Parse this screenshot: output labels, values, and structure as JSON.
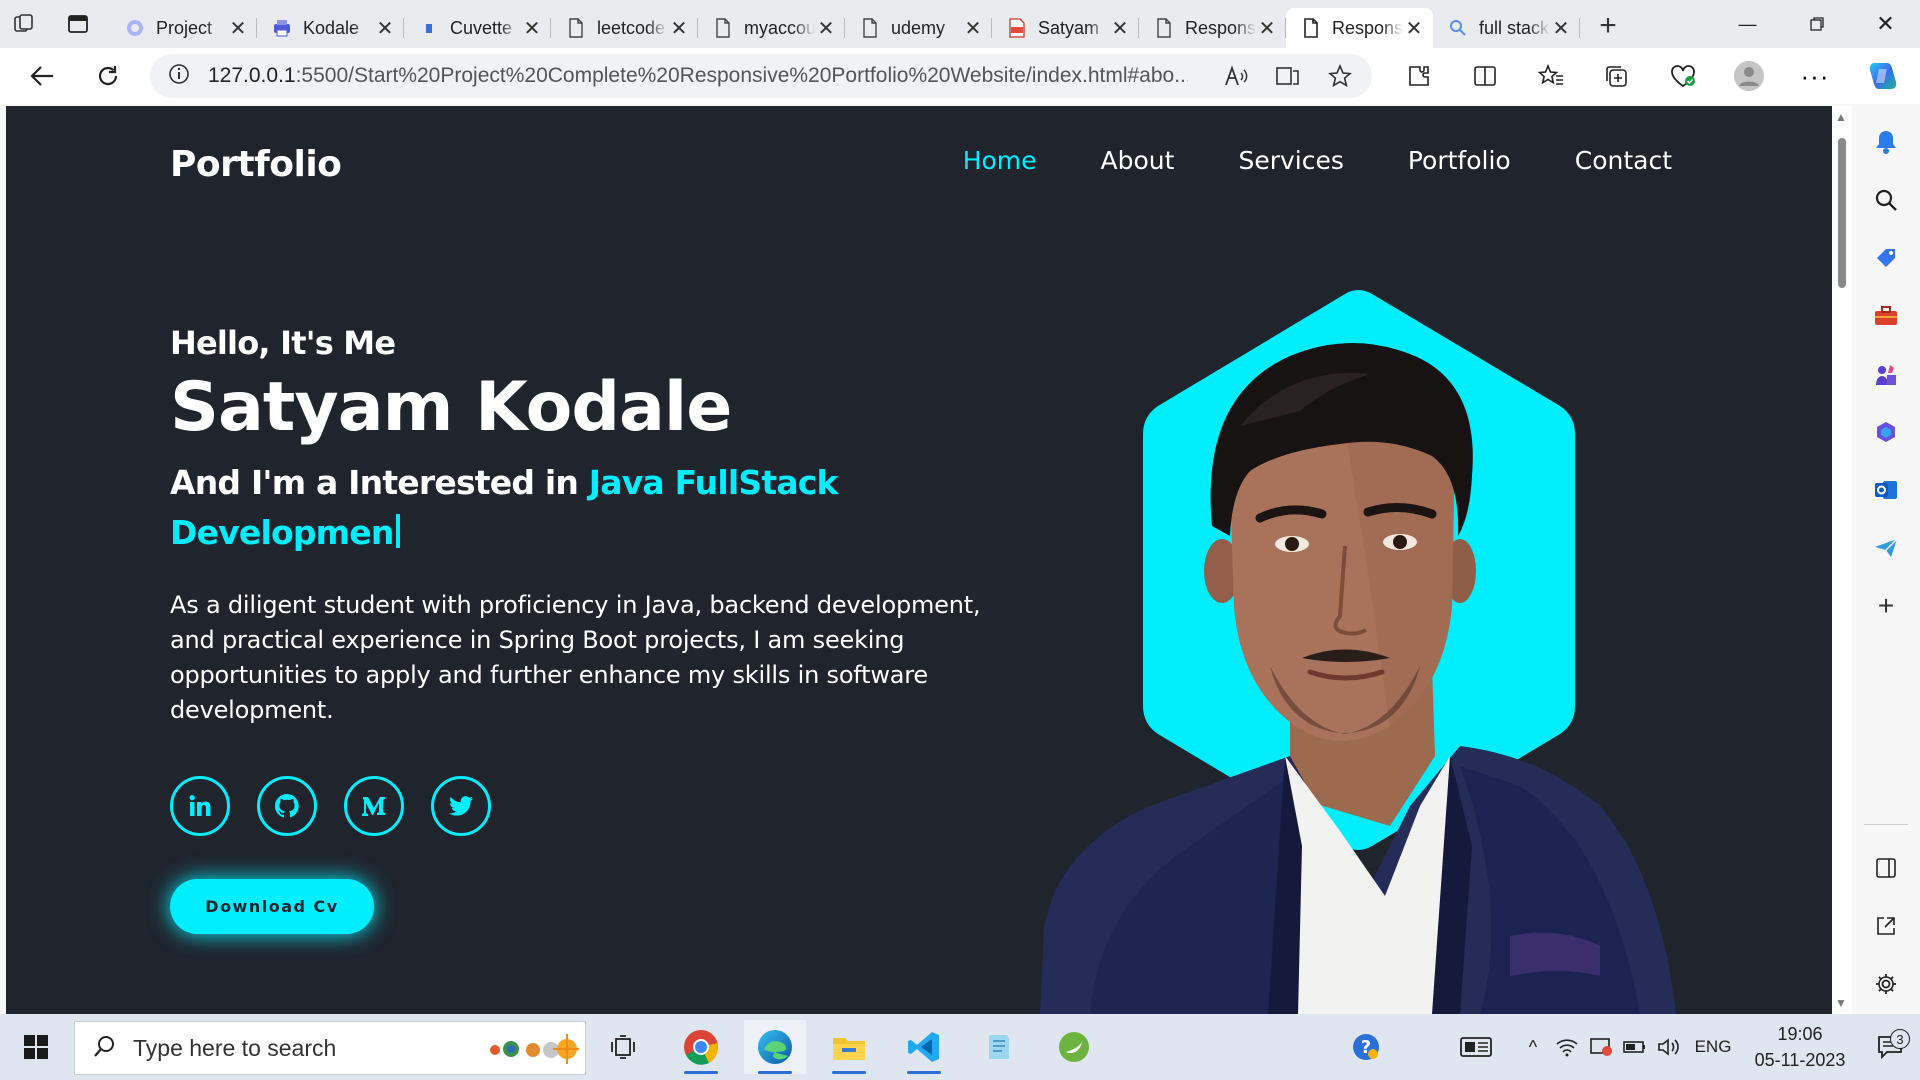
{
  "browser": {
    "tabs": [
      {
        "title": "Project",
        "icon": "copilot-icon"
      },
      {
        "title": "Kodale",
        "icon": "printer-icon"
      },
      {
        "title": "Cuvette",
        "icon": "cuvette-icon"
      },
      {
        "title": "leetcode",
        "icon": "page-icon"
      },
      {
        "title": "myaccount",
        "icon": "page-icon"
      },
      {
        "title": "udemy",
        "icon": "page-icon"
      },
      {
        "title": "Satyam",
        "icon": "pdf-icon"
      },
      {
        "title": "Responsive",
        "icon": "page-icon"
      },
      {
        "title": "Responsive",
        "icon": "page-icon",
        "active": true
      },
      {
        "title": "full stack",
        "icon": "search-icon"
      }
    ],
    "address": {
      "host": "127.0.0.1",
      "rest": ":5500/Start%20Project%20Complete%20Responsive%20Portfolio%20Website/index.html#abo..."
    }
  },
  "site": {
    "logo": "Portfolio",
    "nav": [
      "Home",
      "About",
      "Services",
      "Portfolio",
      "Contact"
    ],
    "nav_active": "Home",
    "hello": "Hello, It's Me",
    "name": "Satyam Kodale",
    "interest_prefix": "And I'm a Interested in ",
    "interest_typed": "Java FullStack Developmen",
    "bio": "As a diligent student with proficiency in Java, backend development, and practical experience in Spring Boot projects, I am seeking opportunities to apply and further enhance my skills in software development.",
    "socials": [
      "linkedin-icon",
      "github-icon",
      "medium-icon",
      "twitter-icon"
    ],
    "download_label": "Download Cv"
  },
  "taskbar": {
    "search_placeholder": "Type here to search",
    "lang": "ENG",
    "time": "19:06",
    "date": "05-11-2023",
    "notifications": "3"
  },
  "colors": {
    "accent": "#00eeff",
    "page_bg": "#1f242d",
    "text": "#ffffff"
  }
}
